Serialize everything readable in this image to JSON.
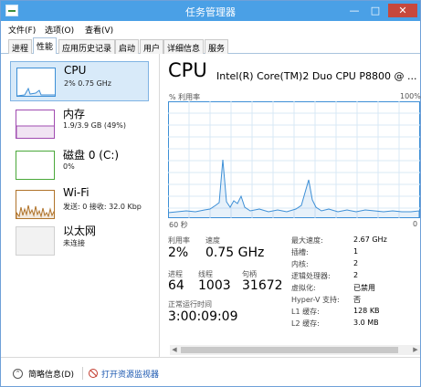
{
  "window": {
    "title": "任务管理器",
    "controls": {
      "minimize": "—",
      "maximize": "□",
      "close": "✕"
    }
  },
  "menu": [
    "文件(F)",
    "选项(O)",
    "查看(V)"
  ],
  "tabs": [
    "进程",
    "性能",
    "应用历史记录",
    "启动",
    "用户",
    "详细信息",
    "服务"
  ],
  "active_tab": "性能",
  "sidebar": {
    "items": [
      {
        "title": "CPU",
        "sub": "2% 0.75 GHz",
        "color": "#3d8fd6",
        "selected": true
      },
      {
        "title": "内存",
        "sub": "1.9/3.9 GB (49%)",
        "color": "#a04bb0",
        "selected": false
      },
      {
        "title": "磁盘 0 (C:)",
        "sub": "0%",
        "color": "#4aa83a",
        "selected": false
      },
      {
        "title": "Wi-Fi",
        "sub": "发送: 0 接收: 32.0 Kbp",
        "color": "#b0732a",
        "selected": false
      },
      {
        "title": "以太网",
        "sub": "未连接",
        "color": "#b0b0b0",
        "selected": false
      }
    ]
  },
  "main": {
    "title": "CPU",
    "model": "Intel(R) Core(TM)2 Duo CPU P8800 @ ...",
    "util_label": "% 利用率",
    "util_max": "100%",
    "time_label": "60 秒",
    "time_end": "0",
    "graph_color": "#3d8fd6",
    "stats": {
      "utilization_label": "利用率",
      "utilization": "2%",
      "speed_label": "速度",
      "speed": "0.75 GHz",
      "processes_label": "进程",
      "processes": "64",
      "threads_label": "线程",
      "threads": "1003",
      "handles_label": "句柄",
      "handles": "31672",
      "uptime_label": "正常运行时间",
      "uptime": "3:00:09:09"
    },
    "details": [
      {
        "label": "最大速度:",
        "value": "2.67 GHz"
      },
      {
        "label": "插槽:",
        "value": "1"
      },
      {
        "label": "内核:",
        "value": "2"
      },
      {
        "label": "逻辑处理器:",
        "value": "2"
      },
      {
        "label": "虚拟化:",
        "value": "已禁用"
      },
      {
        "label": "Hyper-V 支持:",
        "value": "否"
      },
      {
        "label": "L1 缓存:",
        "value": "128 KB"
      },
      {
        "label": "L2 缓存:",
        "value": "3.0 MB"
      }
    ]
  },
  "footer": {
    "summary": "简略信息(D)",
    "open_monitor": "打开资源监视器"
  }
}
